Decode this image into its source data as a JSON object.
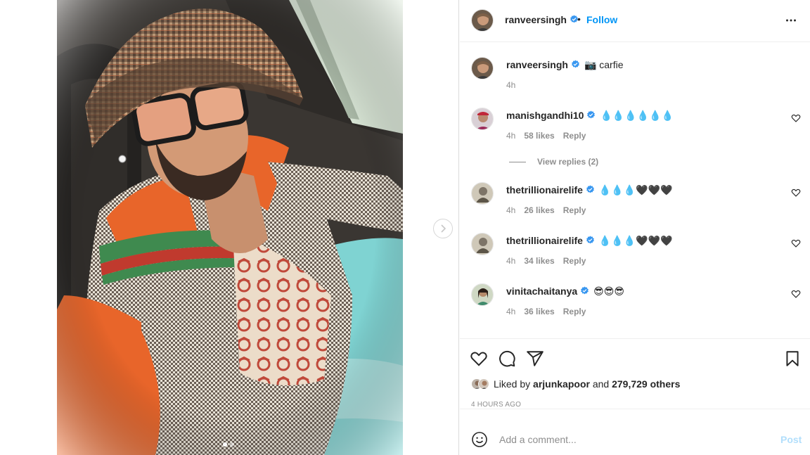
{
  "post": {
    "author": "ranveersingh",
    "follow_label": "Follow",
    "separator": "•",
    "caption": {
      "username": "ranveersingh",
      "text": "📷 carfie",
      "time": "4h"
    }
  },
  "comments": [
    {
      "username": "manishgandhi10",
      "text": "💧💧💧💧💧💧",
      "time": "4h",
      "likes": "58 likes",
      "reply": "Reply",
      "verified": true
    },
    {
      "username": "thetrillionairelife",
      "text": "💧💧💧🖤🖤🖤",
      "time": "4h",
      "likes": "26 likes",
      "reply": "Reply",
      "verified": true
    },
    {
      "username": "thetrillionairelife",
      "text": "💧💧💧🖤🖤🖤",
      "time": "4h",
      "likes": "34 likes",
      "reply": "Reply",
      "verified": true
    },
    {
      "username": "vinitachaitanya",
      "text": "😎😎😎",
      "time": "4h",
      "likes": "36 likes",
      "reply": "Reply",
      "verified": true
    }
  ],
  "view_replies": "View replies (2)",
  "likes": {
    "prefix": "Liked by",
    "user": "arjunkapoor",
    "middle": "and",
    "count": "279,729 others"
  },
  "timestamp": "4 HOURS AGO",
  "add_comment": {
    "placeholder": "Add a comment...",
    "post_label": "Post"
  },
  "colors": {
    "accent": "#0095f6",
    "post_disabled": "#b2dffc",
    "muted": "#8e8e8e",
    "verified": "#3897f0"
  },
  "icons": [
    "more-options-icon",
    "verified-badge-icon",
    "heart-icon",
    "comment-icon",
    "share-icon",
    "bookmark-icon",
    "emoji-icon",
    "chevron-right-icon"
  ]
}
